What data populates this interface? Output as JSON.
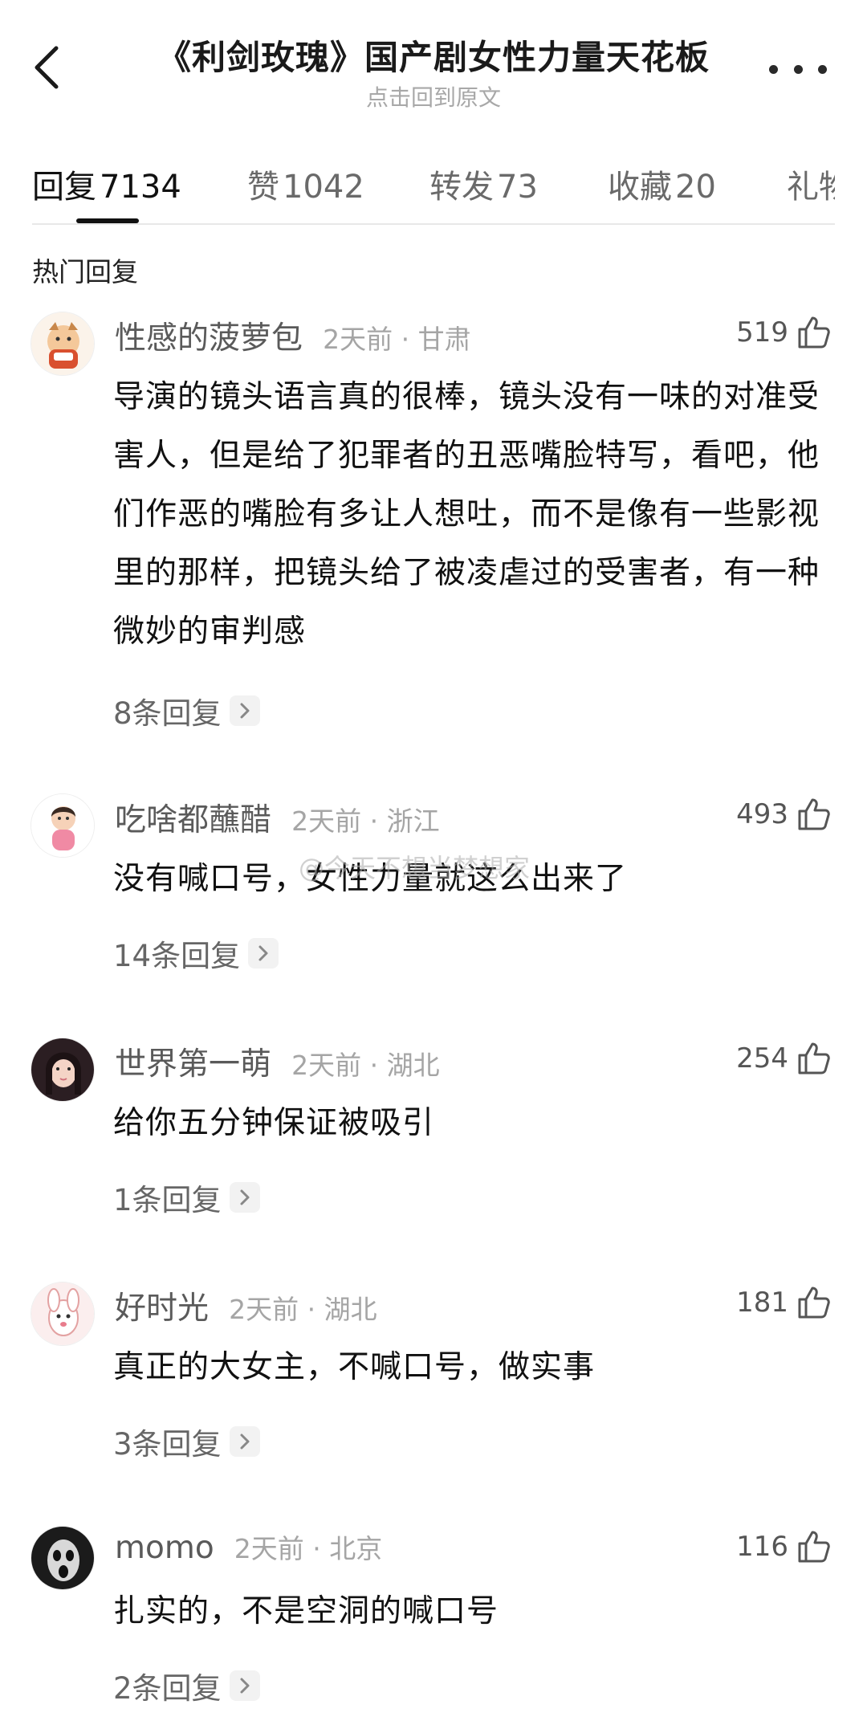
{
  "header": {
    "title": "《利剑玫瑰》国产剧女性力量天花板",
    "subtitle": "点击回到原文"
  },
  "tabs": [
    {
      "label": "回复",
      "count": "7134",
      "active": true
    },
    {
      "label": "赞",
      "count": "1042",
      "active": false
    },
    {
      "label": "转发",
      "count": "73",
      "active": false
    },
    {
      "label": "收藏",
      "count": "20",
      "active": false
    },
    {
      "label": "礼物",
      "count": "",
      "active": false
    }
  ],
  "section": {
    "hot_replies_label": "热门回复"
  },
  "comments": [
    {
      "username": "性感的菠萝包",
      "time_location": "2天前 · 甘肃",
      "likes": "519",
      "text": "导演的镜头语言真的很棒，镜头没有一味的对准受害人，但是给了犯罪者的丑恶嘴脸特写，看吧，他们作恶的嘴脸有多让人想吐，而不是像有一些影视里的那样，把镜头给了被凌虐过的受害者，有一种微妙的审判感",
      "replies": "8条回复"
    },
    {
      "username": "吃啥都蘸醋",
      "time_location": "2天前 · 浙江",
      "likes": "493",
      "text": "没有喊口号，女性力量就这么出来了",
      "replies": "14条回复"
    },
    {
      "username": "世界第一萌",
      "time_location": "2天前 · 湖北",
      "likes": "254",
      "text": "给你五分钟保证被吸引",
      "replies": "1条回复"
    },
    {
      "username": "好时光",
      "time_location": "2天前 · 湖北",
      "likes": "181",
      "text": "真正的大女主，不喊口号，做实事",
      "replies": "3条回复"
    },
    {
      "username": "momo",
      "time_location": "2天前 · 北京",
      "likes": "116",
      "text": "扎实的，不是空洞的喊口号",
      "replies": "2条回复"
    }
  ],
  "watermark": "@今天不想当梦想家",
  "icons": {
    "back": "chevron-left-icon",
    "more": "more-dots-icon",
    "like": "thumbs-up-icon",
    "reply_arrow": "chevron-right-icon"
  }
}
